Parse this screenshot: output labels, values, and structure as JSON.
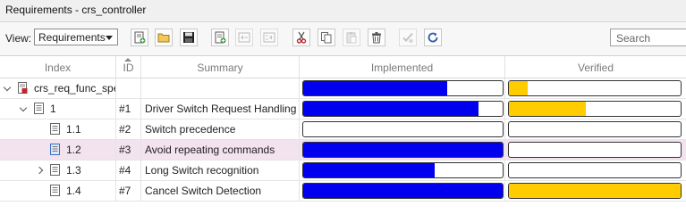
{
  "window": {
    "title": "Requirements - crs_controller"
  },
  "toolbar": {
    "view_label": "View:",
    "view_value": "Requirements",
    "search_placeholder": "Search",
    "buttons": [
      "add-requirement-set",
      "open-folder",
      "save",
      "add-requirement",
      "promote",
      "demote",
      "cut",
      "copy",
      "paste",
      "delete",
      "verify",
      "refresh"
    ]
  },
  "colors": {
    "implemented": "#0000ee",
    "verified": "#ffcc00",
    "selected_row": "#f3e3ef"
  },
  "columns": {
    "index": "Index",
    "id": "ID",
    "summary": "Summary",
    "implemented": "Implemented",
    "verified": "Verified"
  },
  "rows": [
    {
      "index": "crs_req_func_spec",
      "id": "",
      "summary": "",
      "implemented": 0.72,
      "verified": 0.11,
      "level": 0,
      "expander": "down",
      "selected": false,
      "icon": "req-set-file-icon"
    },
    {
      "index": "1",
      "id": "#1",
      "summary": "Driver Switch Request Handling",
      "implemented": 0.88,
      "verified": 0.45,
      "level": 1,
      "expander": "down",
      "selected": false,
      "icon": "requirement-icon"
    },
    {
      "index": "1.1",
      "id": "#2",
      "summary": "Switch precedence",
      "implemented": 0.0,
      "verified": 0.0,
      "level": 2,
      "expander": "none",
      "selected": false,
      "icon": "requirement-icon"
    },
    {
      "index": "1.2",
      "id": "#3",
      "summary": "Avoid repeating commands",
      "implemented": 1.0,
      "verified": 0.0,
      "level": 2,
      "expander": "none",
      "selected": true,
      "icon": "requirement-icon"
    },
    {
      "index": "1.3",
      "id": "#4",
      "summary": "Long Switch recognition",
      "implemented": 0.66,
      "verified": 0.0,
      "level": 2,
      "expander": "right",
      "selected": false,
      "icon": "requirement-icon"
    },
    {
      "index": "1.4",
      "id": "#7",
      "summary": "Cancel Switch Detection",
      "implemented": 1.0,
      "verified": 1.0,
      "level": 2,
      "expander": "none",
      "selected": false,
      "icon": "requirement-icon"
    }
  ]
}
